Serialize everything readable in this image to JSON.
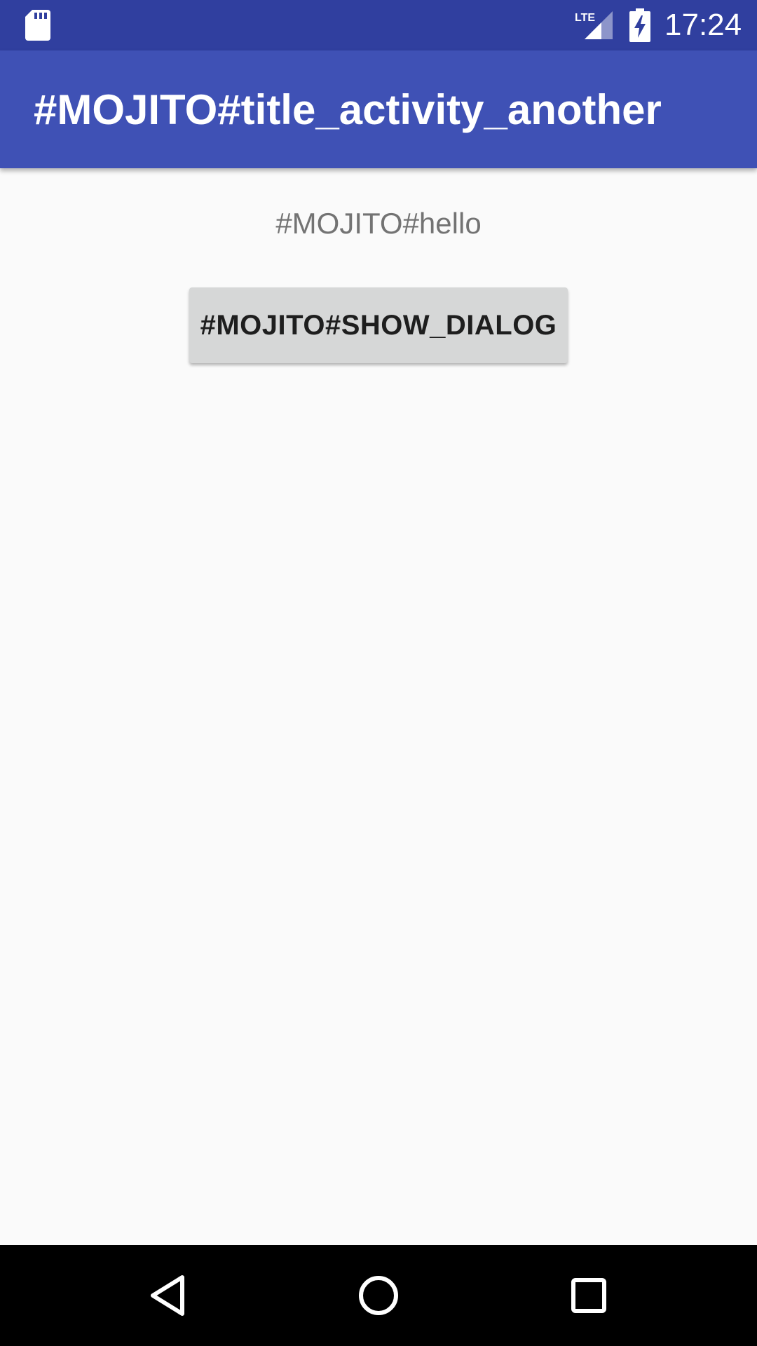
{
  "status_bar": {
    "time": "17:24",
    "network_label": "LTE",
    "icons": [
      "sd-card-icon",
      "lte-signal-icon",
      "battery-charging-icon"
    ],
    "background_color": "#303f9f"
  },
  "app_bar": {
    "title": "#MOJITO#title_activity_another",
    "background_color": "#3f51b5"
  },
  "content": {
    "hello_text": "#MOJITO#hello",
    "show_dialog_button_label": "#MOJITO#SHOW_DIALOG"
  },
  "nav_bar": {
    "icons": [
      "back-icon",
      "home-icon",
      "recent-apps-icon"
    ]
  }
}
